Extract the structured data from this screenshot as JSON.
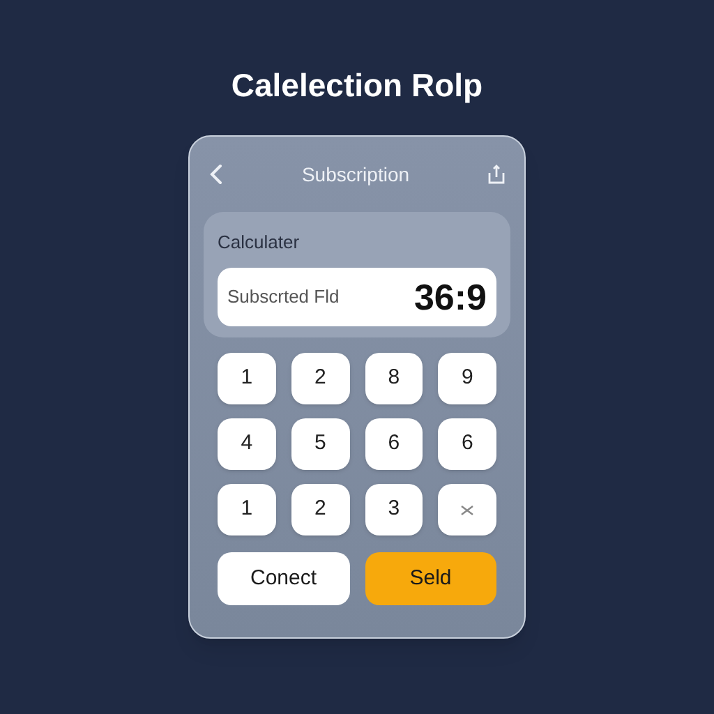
{
  "page_title": "Calelection Rolp",
  "header": {
    "title": "Subscription"
  },
  "calculator": {
    "label": "Calculater",
    "field_label": "Subscrted Fld",
    "display": "36:9"
  },
  "keys": [
    {
      "kind": "digit",
      "label": "1"
    },
    {
      "kind": "digit",
      "label": "2"
    },
    {
      "kind": "digit",
      "label": "8"
    },
    {
      "kind": "digit",
      "label": "9"
    },
    {
      "kind": "digit",
      "label": "4"
    },
    {
      "kind": "digit",
      "label": "5"
    },
    {
      "kind": "digit",
      "label": "6"
    },
    {
      "kind": "digit",
      "label": "6"
    },
    {
      "kind": "digit",
      "label": "1"
    },
    {
      "kind": "digit",
      "label": "2"
    },
    {
      "kind": "digit",
      "label": "3"
    },
    {
      "kind": "clear"
    }
  ],
  "actions": [
    {
      "kind": "secondary",
      "label": "Conect"
    },
    {
      "kind": "primary",
      "label": "Seld"
    }
  ]
}
